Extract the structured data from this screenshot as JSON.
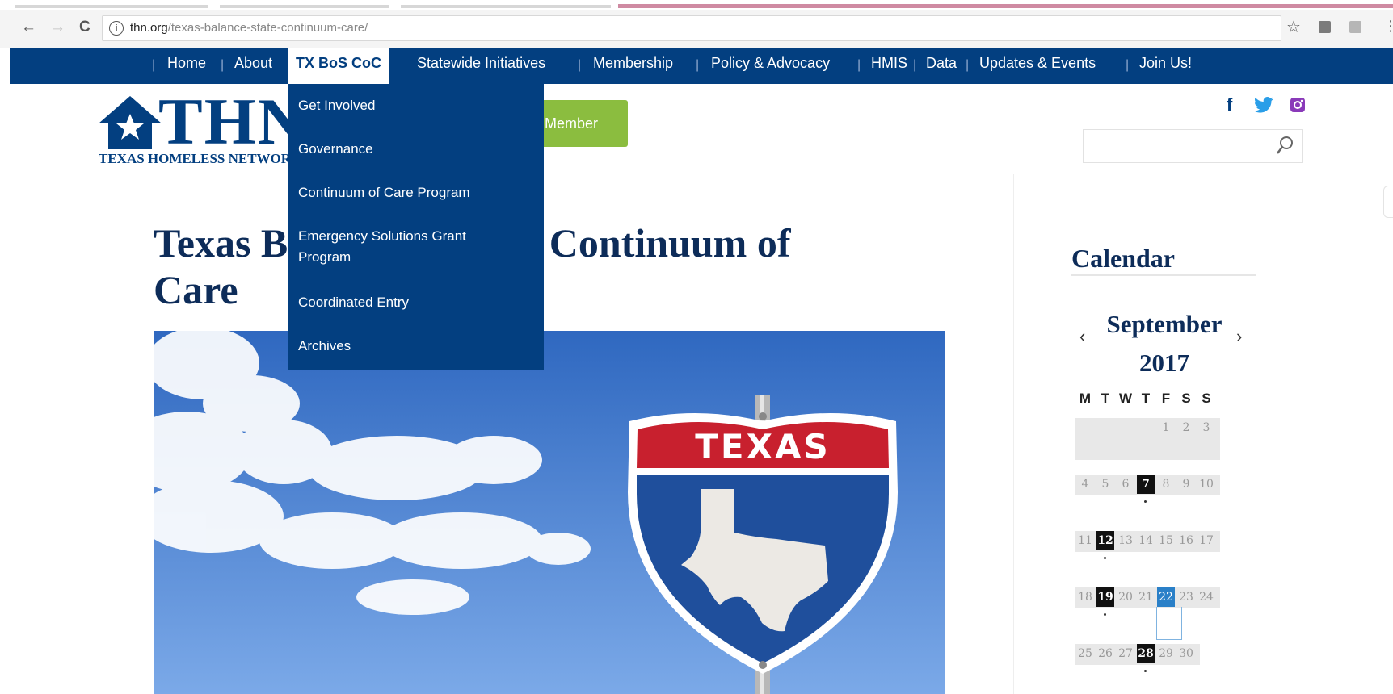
{
  "browser": {
    "back_icon": "←",
    "forward_icon": "→",
    "reload_icon": "C",
    "url_host": "thn.org",
    "url_path": "/texas-balance-state-continuum-care/",
    "info_icon": "i",
    "star_icon": "☆",
    "menu_icon": "⋮"
  },
  "nav": {
    "items": [
      "Home",
      "About",
      "TX BoS CoC",
      "Statewide Initiatives",
      "Membership",
      "Policy & Advocacy",
      "HMIS",
      "Data",
      "Updates & Events",
      "Join Us!"
    ],
    "active": "TX BoS CoC",
    "dropdown": [
      "Get Involved",
      "Governance",
      "Continuum of Care Program",
      "Emergency Solutions Grant Program",
      "Coordinated Entry",
      "Archives"
    ]
  },
  "header": {
    "logo_letters": "THN",
    "logo_subtitle": "TEXAS HOMELESS NETWORK",
    "member_button": "Member",
    "social": {
      "facebook": "f",
      "twitter": "🐦",
      "instagram": "◙"
    },
    "search_icon": "⚲"
  },
  "page": {
    "title_line1": "Texas Balance of State Continuum of",
    "title_line2": "Care"
  },
  "hero": {
    "sign_text": "TEXAS"
  },
  "calendar": {
    "heading": "Calendar",
    "month": "September",
    "year": "2017",
    "prev_icon": "‹",
    "next_icon": "›",
    "weekdays": [
      "M",
      "T",
      "W",
      "T",
      "F",
      "S",
      "S"
    ],
    "weeks": [
      [
        "",
        "",
        "",
        "",
        "1",
        "2",
        "3"
      ],
      [
        "4",
        "5",
        "6",
        "7",
        "8",
        "9",
        "10"
      ],
      [
        "11",
        "12",
        "13",
        "14",
        "15",
        "16",
        "17"
      ],
      [
        "18",
        "19",
        "20",
        "21",
        "22",
        "23",
        "24"
      ],
      [
        "25",
        "26",
        "27",
        "28",
        "29",
        "30",
        ""
      ]
    ],
    "event_days": [
      "7",
      "12",
      "19",
      "28"
    ],
    "today": "22"
  },
  "colors": {
    "brand_blue": "#033f80",
    "title_navy": "#0d2c59",
    "member_green": "#8bbd3f",
    "today_blue": "#2a80c8"
  }
}
